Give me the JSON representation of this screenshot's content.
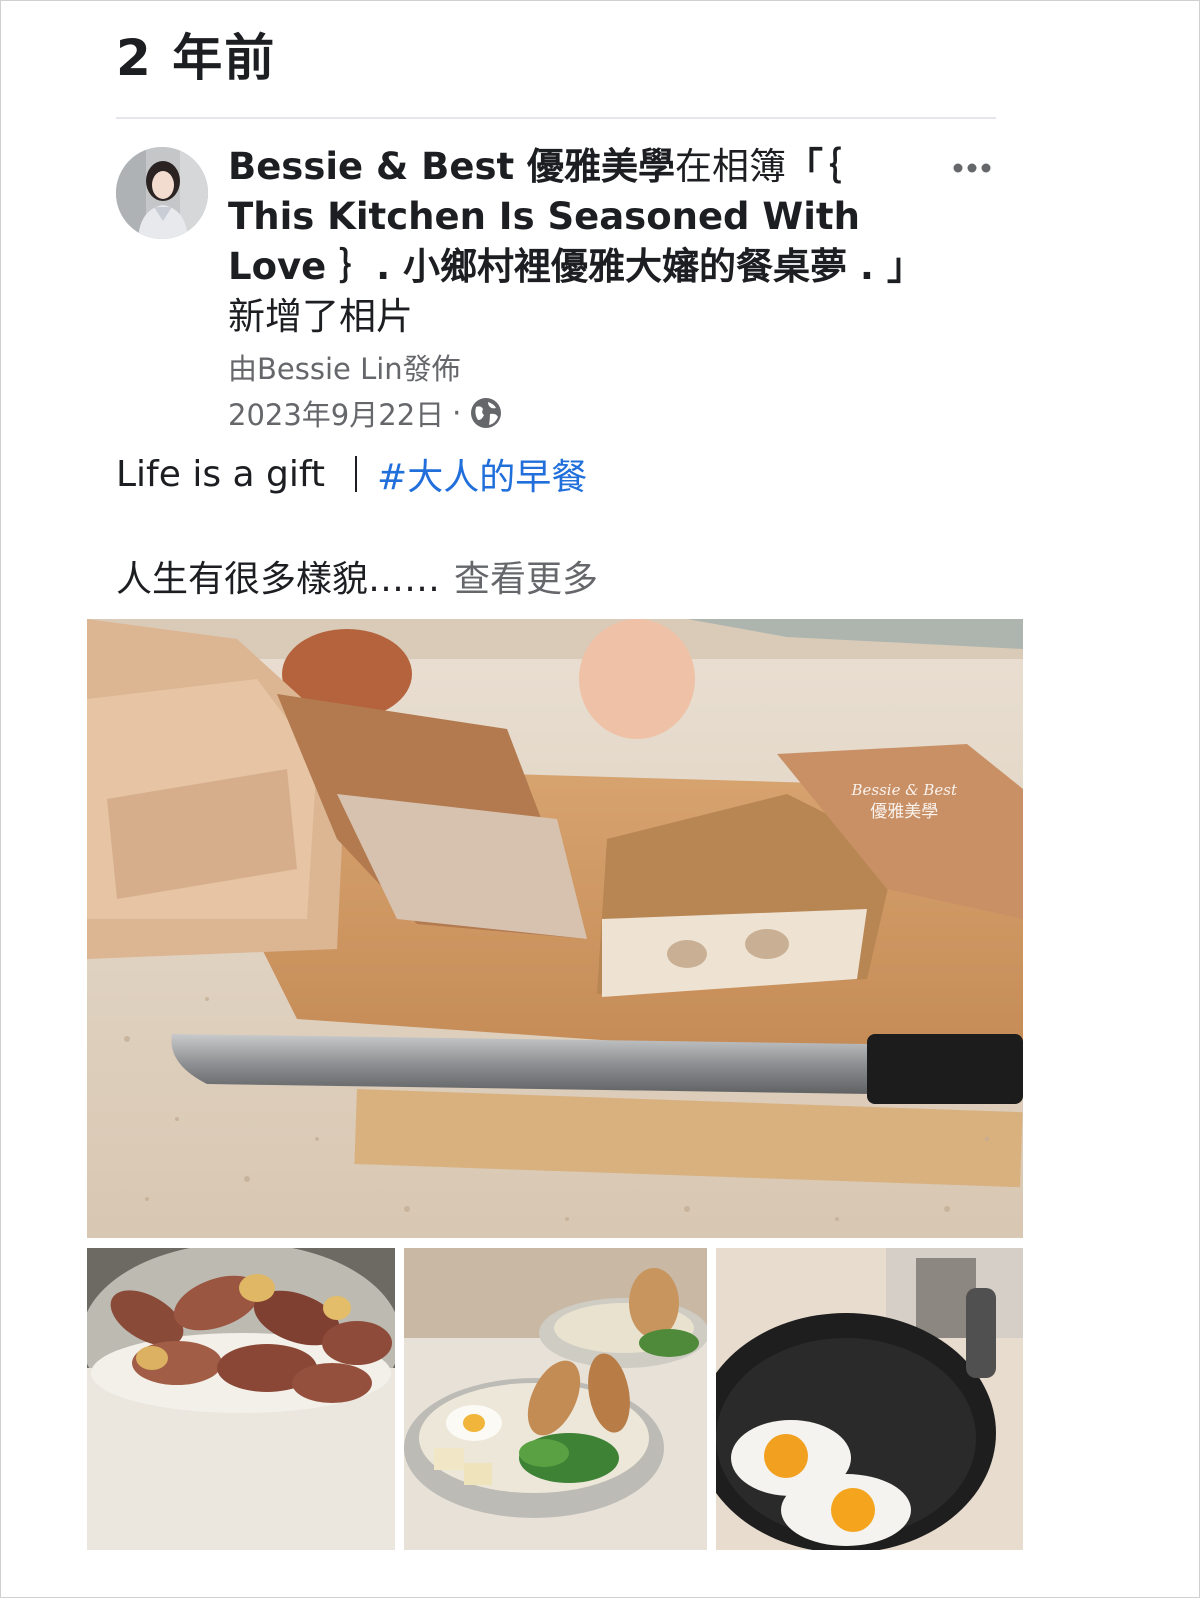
{
  "memory": {
    "time_ago": "2 年前"
  },
  "post": {
    "author": "Bessie & Best 優雅美學",
    "action_prefix": "在相簿",
    "album_title": "「｛ This Kitchen Is Seasoned With Love ｝. 小鄉村裡優雅大嬸的餐桌夢 . 」",
    "action_suffix": "新增了相片",
    "byline": "由Bessie Lin發佈",
    "date": "2023年9月22日",
    "date_separator": "·",
    "audience_icon": "globe-icon",
    "more_icon": "more-horizontal-icon",
    "caption_text": "Life is a gift",
    "hashtag": "#大人的早餐",
    "body_preview": "人生有很多樣貌……",
    "see_more": "查看更多"
  },
  "photos": {
    "main": {
      "subject": "baguette-on-cutting-board-with-knife",
      "watermark_line1": "Bessie & Best",
      "watermark_line2": "優雅美學"
    },
    "thumbnails": [
      {
        "subject": "steamed-sweet-potatoes"
      },
      {
        "subject": "breakfast-salad-bowls"
      },
      {
        "subject": "fried-eggs-in-wok"
      }
    ]
  },
  "colors": {
    "hashtag": "#216fdb",
    "secondary_text": "#65676b",
    "primary_text": "#1c1e21"
  }
}
